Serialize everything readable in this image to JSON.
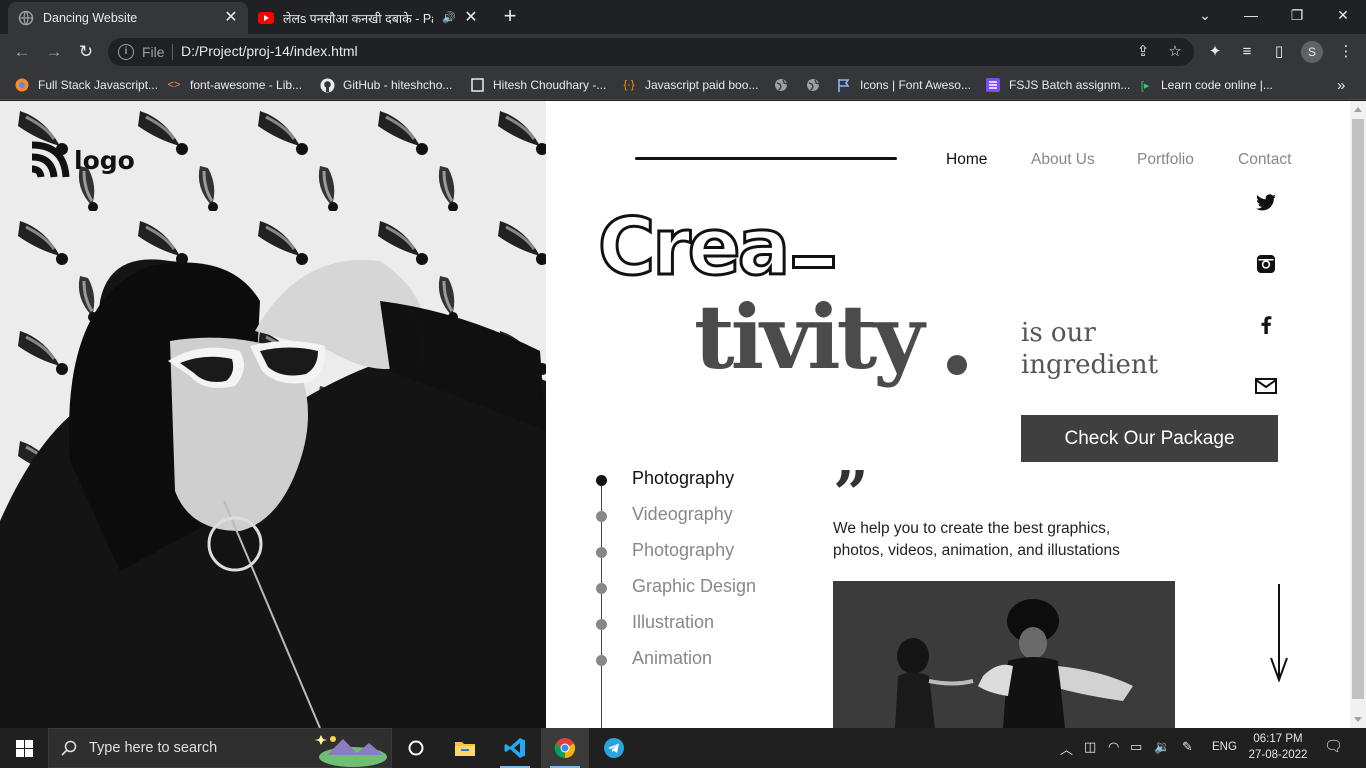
{
  "browser": {
    "tabs": [
      {
        "title": "Dancing Website",
        "active": true,
        "close": "✕"
      },
      {
        "title": "लेलs पनसौआ कनखी दबाके - Pa",
        "active": false,
        "close": "✕"
      }
    ],
    "new_tab": "+",
    "window_controls": {
      "minimize": "—",
      "restore": "❐",
      "close": "✕",
      "tab_search": "⌄"
    },
    "omnibox": {
      "scheme": "File",
      "url": "D:/Project/proj-14/index.html"
    },
    "profile_initial": "S",
    "bookmarks": [
      {
        "label": "Full Stack Javascript...",
        "icon": "orange-circle-icon"
      },
      {
        "label": "font-awesome - Lib...",
        "icon": "code-icon"
      },
      {
        "label": "GitHub - hiteshcho...",
        "icon": "github-icon"
      },
      {
        "label": "Hitesh Choudhary -...",
        "icon": "page-icon"
      },
      {
        "label": "Javascript paid boo...",
        "icon": "braces-icon"
      },
      {
        "label": "",
        "icon": "globe-icon"
      },
      {
        "label": "",
        "icon": "globe-icon"
      },
      {
        "label": "Icons | Font Aweso...",
        "icon": "flag-icon"
      },
      {
        "label": "FSJS Batch assignm...",
        "icon": "list-icon"
      },
      {
        "label": "Learn code online |...",
        "icon": "play-icon"
      }
    ],
    "bookmarks_overflow": "»"
  },
  "site": {
    "logo_text": "logo",
    "nav": [
      {
        "label": "Home",
        "active": true
      },
      {
        "label": "About Us",
        "active": false
      },
      {
        "label": "Portfolio",
        "active": false
      },
      {
        "label": "Contact",
        "active": false
      }
    ],
    "hero": {
      "line1": "Crea",
      "line2": "tivity",
      "tagline_1": "is our",
      "tagline_2": "ingredient"
    },
    "cta_label": "Check Our Package",
    "services": [
      {
        "label": "Photography",
        "active": true
      },
      {
        "label": "Videography",
        "active": false
      },
      {
        "label": "Photography",
        "active": false
      },
      {
        "label": "Graphic Design",
        "active": false
      },
      {
        "label": "Illustration",
        "active": false
      },
      {
        "label": "Animation",
        "active": false
      }
    ],
    "quote_mark": "”",
    "description": "We help you to create the best graphics, photos, videos, animation, and illustations",
    "social_icons": [
      "twitter-icon",
      "instagram-icon",
      "facebook-icon",
      "mail-icon"
    ]
  },
  "taskbar": {
    "search_placeholder": "Type here to search",
    "apps": [
      "cortana-icon",
      "file-explorer-icon",
      "vscode-icon",
      "chrome-icon",
      "telegram-icon"
    ],
    "language": "ENG",
    "time": "06:17 PM",
    "date": "27-08-2022"
  },
  "colors": {
    "chrome_dark": "#202124",
    "chrome_toolbar": "#35363a",
    "cta_bg": "#3f3f3f",
    "taskbar": "#202020"
  }
}
